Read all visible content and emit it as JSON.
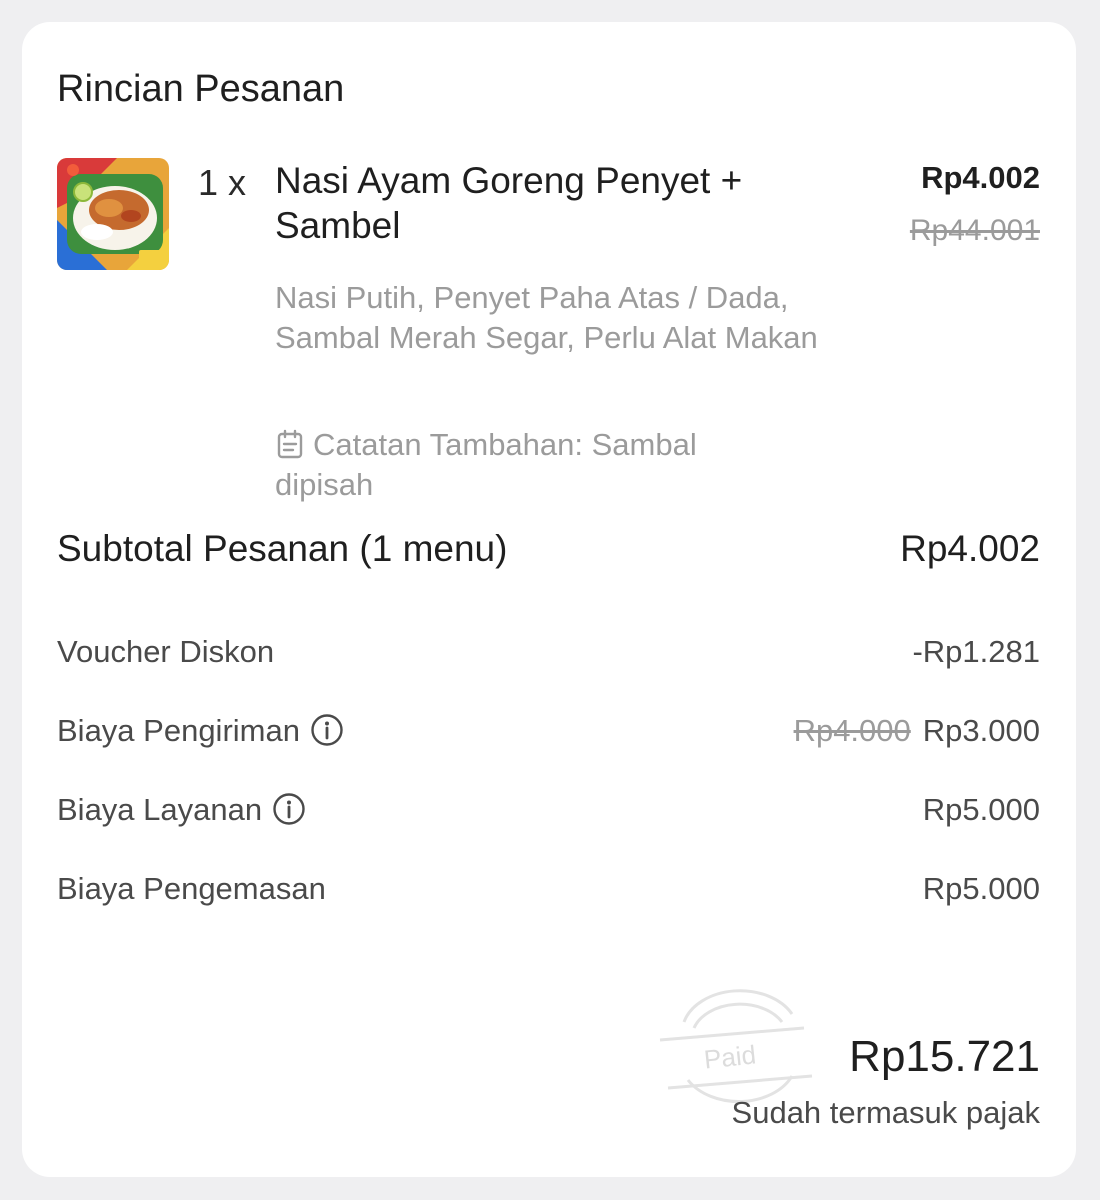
{
  "header": {
    "title": "Rincian Pesanan"
  },
  "order_item": {
    "image": "food-photo",
    "quantity": "1 x",
    "name": "Nasi Ayam Goreng Penyet + Sambel",
    "price": "Rp4.002",
    "original_price": "Rp44.001",
    "options": "Nasi Putih, Penyet Paha Atas / Dada, Sambal Merah Segar, Perlu Alat Makan",
    "note_icon": "notepad-icon",
    "note": "Catatan Tambahan: Sambal dipisah"
  },
  "subtotal": {
    "label": "Subtotal Pesanan (1 menu)",
    "value": "Rp4.002"
  },
  "fees": {
    "voucher": {
      "label": "Voucher Diskon",
      "value": "-Rp1.281"
    },
    "delivery": {
      "label": "Biaya Pengiriman",
      "icon": "info-icon",
      "original_value": "Rp4.000",
      "value": "Rp3.000"
    },
    "service": {
      "label": "Biaya Layanan",
      "icon": "info-icon",
      "value": "Rp5.000"
    },
    "packaging": {
      "label": "Biaya Pengemasan",
      "value": "Rp5.000"
    }
  },
  "total": {
    "stamp_text": "Paid",
    "value": "Rp15.721",
    "note": "Sudah termasuk pajak"
  },
  "colors": {
    "background": "#efeff1",
    "card": "#ffffff",
    "text_primary": "#1f1f1f",
    "text_secondary": "#4a4a4a",
    "text_muted": "#9b9b9b"
  }
}
